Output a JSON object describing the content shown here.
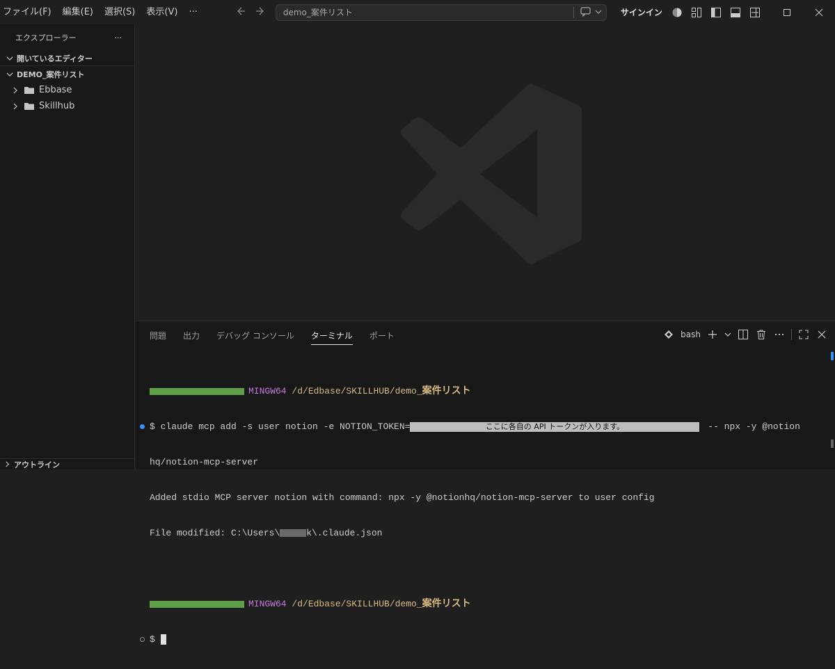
{
  "menu": [
    "ファイル(F)",
    "編集(E)",
    "選択(S)",
    "表示(V)",
    "···"
  ],
  "command_center": {
    "text": "demo_案件リスト"
  },
  "signin": "サインイン",
  "sidebar": {
    "title": "エクスプローラー",
    "more": "···",
    "open_editors": "開いているエディター",
    "workspace": "DEMO_案件リスト",
    "folders": [
      "Ebbase",
      "Skillhub"
    ],
    "outline": "アウトライン"
  },
  "panel": {
    "tabs": [
      "問題",
      "出力",
      "デバッグ コンソール",
      "ターミナル",
      "ポート"
    ],
    "active_tab": "ターミナル",
    "shell": "bash"
  },
  "terminal": {
    "prompt_host": "MINGW64",
    "prompt_path": "/d/Edbase/SKILLHUB/demo_",
    "prompt_path_jp": "案件リスト",
    "command": "$ claude mcp add -s user notion -e NOTION_TOKEN=",
    "token_note": "ここに各自の API トークンが入ります。",
    "command_rest": " -- npx -y @notion",
    "command_wrap": "hq/notion-mcp-server",
    "output1": "Added stdio MCP server notion with command: npx -y @notionhq/notion-mcp-server to user config",
    "output2_a": "File modified: C:\\Users\\",
    "output2_b": "k\\.claude.json",
    "prompt_symbol": "$ "
  }
}
